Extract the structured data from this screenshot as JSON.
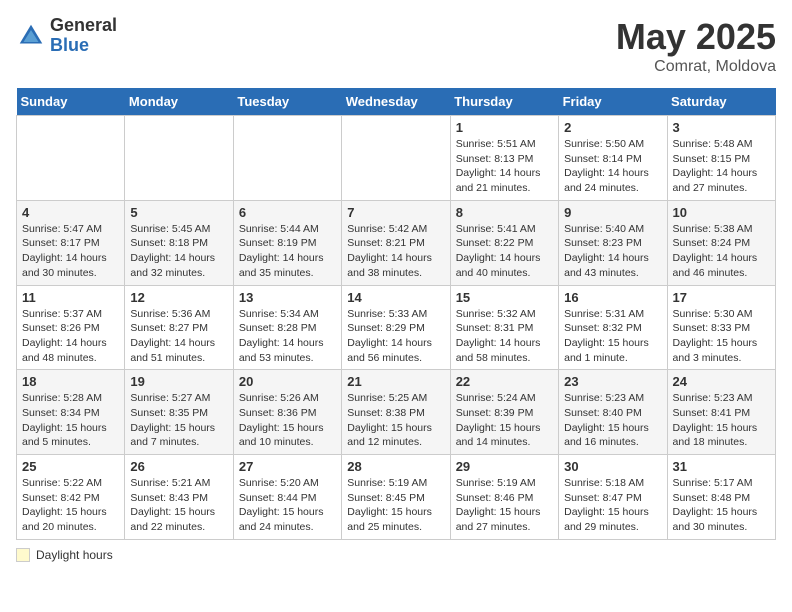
{
  "header": {
    "logo_general": "General",
    "logo_blue": "Blue",
    "month": "May 2025",
    "location": "Comrat, Moldova"
  },
  "days_of_week": [
    "Sunday",
    "Monday",
    "Tuesday",
    "Wednesday",
    "Thursday",
    "Friday",
    "Saturday"
  ],
  "footer": {
    "daylight_label": "Daylight hours"
  },
  "weeks": [
    [
      {
        "day": "",
        "info": ""
      },
      {
        "day": "",
        "info": ""
      },
      {
        "day": "",
        "info": ""
      },
      {
        "day": "",
        "info": ""
      },
      {
        "day": "1",
        "info": "Sunrise: 5:51 AM\nSunset: 8:13 PM\nDaylight: 14 hours and 21 minutes."
      },
      {
        "day": "2",
        "info": "Sunrise: 5:50 AM\nSunset: 8:14 PM\nDaylight: 14 hours and 24 minutes."
      },
      {
        "day": "3",
        "info": "Sunrise: 5:48 AM\nSunset: 8:15 PM\nDaylight: 14 hours and 27 minutes."
      }
    ],
    [
      {
        "day": "4",
        "info": "Sunrise: 5:47 AM\nSunset: 8:17 PM\nDaylight: 14 hours and 30 minutes."
      },
      {
        "day": "5",
        "info": "Sunrise: 5:45 AM\nSunset: 8:18 PM\nDaylight: 14 hours and 32 minutes."
      },
      {
        "day": "6",
        "info": "Sunrise: 5:44 AM\nSunset: 8:19 PM\nDaylight: 14 hours and 35 minutes."
      },
      {
        "day": "7",
        "info": "Sunrise: 5:42 AM\nSunset: 8:21 PM\nDaylight: 14 hours and 38 minutes."
      },
      {
        "day": "8",
        "info": "Sunrise: 5:41 AM\nSunset: 8:22 PM\nDaylight: 14 hours and 40 minutes."
      },
      {
        "day": "9",
        "info": "Sunrise: 5:40 AM\nSunset: 8:23 PM\nDaylight: 14 hours and 43 minutes."
      },
      {
        "day": "10",
        "info": "Sunrise: 5:38 AM\nSunset: 8:24 PM\nDaylight: 14 hours and 46 minutes."
      }
    ],
    [
      {
        "day": "11",
        "info": "Sunrise: 5:37 AM\nSunset: 8:26 PM\nDaylight: 14 hours and 48 minutes."
      },
      {
        "day": "12",
        "info": "Sunrise: 5:36 AM\nSunset: 8:27 PM\nDaylight: 14 hours and 51 minutes."
      },
      {
        "day": "13",
        "info": "Sunrise: 5:34 AM\nSunset: 8:28 PM\nDaylight: 14 hours and 53 minutes."
      },
      {
        "day": "14",
        "info": "Sunrise: 5:33 AM\nSunset: 8:29 PM\nDaylight: 14 hours and 56 minutes."
      },
      {
        "day": "15",
        "info": "Sunrise: 5:32 AM\nSunset: 8:31 PM\nDaylight: 14 hours and 58 minutes."
      },
      {
        "day": "16",
        "info": "Sunrise: 5:31 AM\nSunset: 8:32 PM\nDaylight: 15 hours and 1 minute."
      },
      {
        "day": "17",
        "info": "Sunrise: 5:30 AM\nSunset: 8:33 PM\nDaylight: 15 hours and 3 minutes."
      }
    ],
    [
      {
        "day": "18",
        "info": "Sunrise: 5:28 AM\nSunset: 8:34 PM\nDaylight: 15 hours and 5 minutes."
      },
      {
        "day": "19",
        "info": "Sunrise: 5:27 AM\nSunset: 8:35 PM\nDaylight: 15 hours and 7 minutes."
      },
      {
        "day": "20",
        "info": "Sunrise: 5:26 AM\nSunset: 8:36 PM\nDaylight: 15 hours and 10 minutes."
      },
      {
        "day": "21",
        "info": "Sunrise: 5:25 AM\nSunset: 8:38 PM\nDaylight: 15 hours and 12 minutes."
      },
      {
        "day": "22",
        "info": "Sunrise: 5:24 AM\nSunset: 8:39 PM\nDaylight: 15 hours and 14 minutes."
      },
      {
        "day": "23",
        "info": "Sunrise: 5:23 AM\nSunset: 8:40 PM\nDaylight: 15 hours and 16 minutes."
      },
      {
        "day": "24",
        "info": "Sunrise: 5:23 AM\nSunset: 8:41 PM\nDaylight: 15 hours and 18 minutes."
      }
    ],
    [
      {
        "day": "25",
        "info": "Sunrise: 5:22 AM\nSunset: 8:42 PM\nDaylight: 15 hours and 20 minutes."
      },
      {
        "day": "26",
        "info": "Sunrise: 5:21 AM\nSunset: 8:43 PM\nDaylight: 15 hours and 22 minutes."
      },
      {
        "day": "27",
        "info": "Sunrise: 5:20 AM\nSunset: 8:44 PM\nDaylight: 15 hours and 24 minutes."
      },
      {
        "day": "28",
        "info": "Sunrise: 5:19 AM\nSunset: 8:45 PM\nDaylight: 15 hours and 25 minutes."
      },
      {
        "day": "29",
        "info": "Sunrise: 5:19 AM\nSunset: 8:46 PM\nDaylight: 15 hours and 27 minutes."
      },
      {
        "day": "30",
        "info": "Sunrise: 5:18 AM\nSunset: 8:47 PM\nDaylight: 15 hours and 29 minutes."
      },
      {
        "day": "31",
        "info": "Sunrise: 5:17 AM\nSunset: 8:48 PM\nDaylight: 15 hours and 30 minutes."
      }
    ]
  ]
}
